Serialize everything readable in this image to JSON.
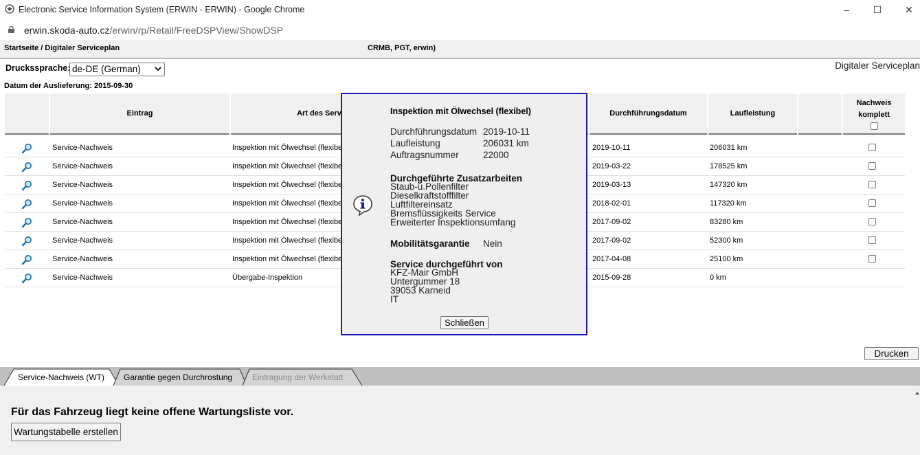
{
  "window": {
    "title": "Electronic Service Information System (ERWIN - ERWIN) - Google Chrome",
    "minimize": "–",
    "maximize": "☐",
    "close": "✕"
  },
  "address": {
    "host": "erwin.skoda-auto.cz",
    "path": "/erwin/rp/Retail/FreeDSPView/ShowDSP"
  },
  "header": {
    "breadcrumb": "Startseite / Digitaler Serviceplan",
    "context": "CRMB, PGT, erwin)"
  },
  "print_language": {
    "label": "Druckssprache:",
    "selected": "de-DE (German)"
  },
  "page_title": "Digitaler Serviceplan",
  "delivery_date": "Datum der Auslieferung: 2015-09-30",
  "table": {
    "headers": {
      "entry": "Eintrag",
      "type": "Art des Servi",
      "date": "Durchführungsdatum",
      "mileage": "Laufleistung",
      "complete": "Nachweis komplett"
    },
    "rows": [
      {
        "entry": "Service-Nachweis",
        "type": "Inspektion mit Ölwechsel (flexibe",
        "date": "2019-10-11",
        "mileage": "206031 km",
        "checkbox": true
      },
      {
        "entry": "Service-Nachweis",
        "type": "Inspektion mit Ölwechsel (flexibe",
        "date": "2019-03-22",
        "mileage": "178525 km",
        "checkbox": true
      },
      {
        "entry": "Service-Nachweis",
        "type": "Inspektion mit Ölwechsel (flexibe",
        "date": "2019-03-13",
        "mileage": "147320 km",
        "checkbox": true
      },
      {
        "entry": "Service-Nachweis",
        "type": "Inspektion mit Ölwechsel (flexibe",
        "date": "2018-02-01",
        "mileage": "117320 km",
        "checkbox": true
      },
      {
        "entry": "Service-Nachweis",
        "type": "Inspektion mit Ölwechsel (flexibe",
        "date": "2017-09-02",
        "mileage": "83280 km",
        "checkbox": true
      },
      {
        "entry": "Service-Nachweis",
        "type": "Inspektion mit Ölwechsel (flexibe",
        "date": "2017-09-02",
        "mileage": "52300 km",
        "checkbox": true
      },
      {
        "entry": "Service-Nachweis",
        "type": "Inspektion mit Ölwechsel (flexibe",
        "date": "2017-04-08",
        "mileage": "25100 km",
        "checkbox": true
      },
      {
        "entry": "Service-Nachweis",
        "type": "Übergabe-Inspektion",
        "date": "2015-09-28",
        "mileage": "0 km",
        "checkbox": false
      }
    ]
  },
  "popup": {
    "title": "Inspektion mit Ölwechsel (flexibel)",
    "date_label": "Durchführungsdatum",
    "date_value": "2019-10-11",
    "mileage_label": "Laufleistung",
    "mileage_value": "206031 km",
    "order_label": "Auftragsnummer",
    "order_value": "22000",
    "extra_title": "Durchgeführte Zusatzarbeiten",
    "extra_items": [
      "Staub-u.Pollenfilter",
      "Dieselkraftstofffilter",
      "Luftfiltereinsatz",
      "Bremsflüssigkeits Service",
      "Erweiterter Inspektionsumfang"
    ],
    "mobility_label": "Mobilitätsgarantie",
    "mobility_value": "Nein",
    "service_by_title": "Service durchgeführt von",
    "service_by_lines": [
      "KFZ-Mair GmbH",
      "Untergummer 18",
      "39053 Karneid",
      "IT"
    ],
    "close_label": "Schließen"
  },
  "print_button": "Drucken",
  "tabs": [
    {
      "label": "Service-Nachweis (WT)",
      "active": true
    },
    {
      "label": "Garantie gegen Durchrostung",
      "active": false
    },
    {
      "label": "Eintragung der Werkstatt",
      "active": false,
      "disabled": true
    }
  ],
  "panel": {
    "message": "Für das Fahrzeug liegt keine offene Wartungsliste vor.",
    "button": "Wartungstabelle erstellen"
  },
  "colors": {
    "popup_border": "#1a1ab5",
    "header_bg": "#f0f0f0",
    "tabbar_bg": "#c0c0c0"
  }
}
